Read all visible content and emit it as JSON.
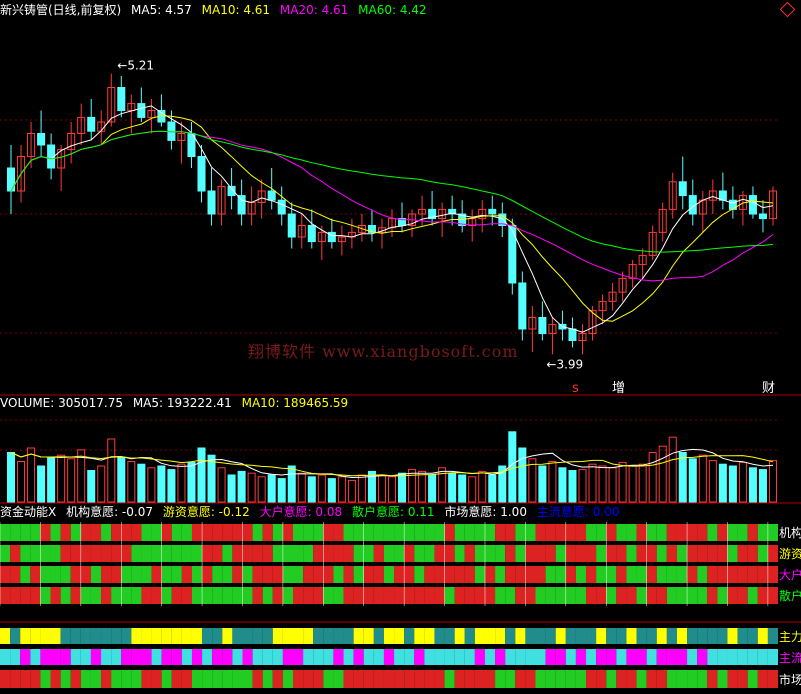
{
  "colors": {
    "up": "#ff3a3a",
    "down": "#54ffff",
    "ma5": "#ffffff",
    "ma10": "#ffff00",
    "ma20": "#ff00ff",
    "ma60": "#00ff00",
    "grid": "#800000",
    "panelBorder": "#b00000"
  },
  "header": {
    "title": "新兴铸管(日线,前复权)",
    "ma5": "MA5: 4.57",
    "ma10": "MA10: 4.61",
    "ma20": "MA20: 4.61",
    "ma60": "MA60: 4.42"
  },
  "annotations": {
    "high": "5.21",
    "low": "3.99",
    "events": [
      {
        "label": "s",
        "color": "#ff3030"
      },
      {
        "label": "增",
        "color": "#ffffff"
      },
      {
        "label": "财",
        "color": "#ffffff"
      }
    ]
  },
  "watermark": "翔博软件 www.xiangbosoft.com",
  "volume": {
    "vol": "VOLUME: 305017.75",
    "ma5": "MA5: 193222.41",
    "ma10": "MA10: 189465.59"
  },
  "fund": {
    "title": "资金动能X",
    "items": [
      {
        "text": "机构意愿: -0.07",
        "color": "#ffffff"
      },
      {
        "text": "游资意愿: -0.12",
        "color": "#ffff00"
      },
      {
        "text": "大户意愿: 0.08",
        "color": "#ff00ff"
      },
      {
        "text": "散户意愿: 0.11",
        "color": "#00ff00"
      },
      {
        "text": "市场意愿: 1.00",
        "color": "#ffffff"
      },
      {
        "text": "主流意愿: 0.00",
        "color": "#0000ff"
      }
    ],
    "rowLabels": [
      {
        "text": "机构",
        "color": "#ffffff"
      },
      {
        "text": "游资",
        "color": "#ffff00"
      },
      {
        "text": "大户",
        "color": "#ff00ff"
      },
      {
        "text": "散户",
        "color": "#00ff00"
      },
      {
        "text": "主力",
        "color": "#ffff00"
      },
      {
        "text": "主流",
        "color": "#ff00ff"
      },
      {
        "text": "市场",
        "color": "#ffffff"
      }
    ]
  },
  "chart_data": {
    "type": "candlestick",
    "title": "新兴铸管(日线,前复权)",
    "high_label": 5.21,
    "low_label": 3.99,
    "price_range": [
      3.9,
      5.4
    ],
    "series": [
      {
        "name": "MA5",
        "value": 4.57
      },
      {
        "name": "MA10",
        "value": 4.61
      },
      {
        "name": "MA20",
        "value": 4.61
      },
      {
        "name": "MA60",
        "value": 4.42
      }
    ],
    "candles": [
      [
        4.8,
        4.9,
        4.6,
        4.7
      ],
      [
        4.7,
        4.9,
        4.65,
        4.85
      ],
      [
        4.85,
        5.0,
        4.8,
        4.95
      ],
      [
        4.95,
        5.05,
        4.85,
        4.9
      ],
      [
        4.9,
        4.95,
        4.75,
        4.8
      ],
      [
        4.8,
        4.9,
        4.7,
        4.88
      ],
      [
        4.88,
        5.0,
        4.82,
        4.95
      ],
      [
        4.95,
        5.08,
        4.9,
        5.02
      ],
      [
        5.02,
        5.1,
        4.92,
        4.96
      ],
      [
        4.96,
        5.05,
        4.9,
        5.0
      ],
      [
        5.0,
        5.21,
        4.98,
        5.15
      ],
      [
        5.15,
        5.2,
        5.02,
        5.05
      ],
      [
        5.05,
        5.12,
        4.95,
        5.08
      ],
      [
        5.08,
        5.15,
        5.0,
        5.02
      ],
      [
        5.02,
        5.1,
        4.95,
        5.05
      ],
      [
        5.05,
        5.12,
        4.98,
        5.0
      ],
      [
        5.0,
        5.05,
        4.88,
        4.92
      ],
      [
        4.92,
        5.0,
        4.82,
        4.95
      ],
      [
        4.95,
        5.0,
        4.8,
        4.85
      ],
      [
        4.85,
        4.9,
        4.65,
        4.7
      ],
      [
        4.7,
        4.8,
        4.55,
        4.6
      ],
      [
        4.6,
        4.75,
        4.55,
        4.72
      ],
      [
        4.72,
        4.8,
        4.62,
        4.68
      ],
      [
        4.68,
        4.75,
        4.55,
        4.6
      ],
      [
        4.6,
        4.72,
        4.55,
        4.65
      ],
      [
        4.65,
        4.75,
        4.58,
        4.7
      ],
      [
        4.7,
        4.8,
        4.62,
        4.66
      ],
      [
        4.66,
        4.72,
        4.55,
        4.6
      ],
      [
        4.6,
        4.65,
        4.45,
        4.5
      ],
      [
        4.5,
        4.6,
        4.45,
        4.55
      ],
      [
        4.55,
        4.62,
        4.45,
        4.48
      ],
      [
        4.48,
        4.55,
        4.4,
        4.52
      ],
      [
        4.52,
        4.58,
        4.45,
        4.48
      ],
      [
        4.48,
        4.55,
        4.42,
        4.5
      ],
      [
        4.5,
        4.58,
        4.45,
        4.52
      ],
      [
        4.52,
        4.6,
        4.48,
        4.55
      ],
      [
        4.55,
        4.62,
        4.48,
        4.52
      ],
      [
        4.52,
        4.58,
        4.45,
        4.54
      ],
      [
        4.54,
        4.62,
        4.5,
        4.58
      ],
      [
        4.58,
        4.65,
        4.52,
        4.55
      ],
      [
        4.55,
        4.62,
        4.5,
        4.6
      ],
      [
        4.6,
        4.68,
        4.55,
        4.62
      ],
      [
        4.62,
        4.7,
        4.55,
        4.58
      ],
      [
        4.58,
        4.65,
        4.5,
        4.62
      ],
      [
        4.62,
        4.68,
        4.55,
        4.6
      ],
      [
        4.6,
        4.66,
        4.52,
        4.55
      ],
      [
        4.55,
        4.62,
        4.48,
        4.58
      ],
      [
        4.58,
        4.66,
        4.52,
        4.62
      ],
      [
        4.62,
        4.68,
        4.55,
        4.6
      ],
      [
        4.6,
        4.65,
        4.5,
        4.55
      ],
      [
        4.55,
        4.58,
        4.25,
        4.3
      ],
      [
        4.3,
        4.35,
        4.05,
        4.1
      ],
      [
        4.1,
        4.2,
        4.0,
        4.15
      ],
      [
        4.15,
        4.22,
        4.05,
        4.08
      ],
      [
        4.08,
        4.15,
        3.99,
        4.12
      ],
      [
        4.12,
        4.18,
        4.05,
        4.1
      ],
      [
        4.1,
        4.15,
        4.02,
        4.05
      ],
      [
        4.05,
        4.12,
        3.99,
        4.08
      ],
      [
        4.08,
        4.2,
        4.05,
        4.18
      ],
      [
        4.18,
        4.25,
        4.12,
        4.22
      ],
      [
        4.22,
        4.3,
        4.18,
        4.26
      ],
      [
        4.26,
        4.35,
        4.22,
        4.32
      ],
      [
        4.32,
        4.4,
        4.28,
        4.38
      ],
      [
        4.38,
        4.45,
        4.32,
        4.42
      ],
      [
        4.42,
        4.55,
        4.4,
        4.52
      ],
      [
        4.52,
        4.65,
        4.48,
        4.62
      ],
      [
        4.62,
        4.78,
        4.58,
        4.74
      ],
      [
        4.74,
        4.85,
        4.62,
        4.68
      ],
      [
        4.68,
        4.75,
        4.55,
        4.6
      ],
      [
        4.6,
        4.7,
        4.52,
        4.66
      ],
      [
        4.66,
        4.75,
        4.6,
        4.7
      ],
      [
        4.7,
        4.78,
        4.62,
        4.66
      ],
      [
        4.66,
        4.72,
        4.58,
        4.62
      ],
      [
        4.62,
        4.7,
        4.55,
        4.68
      ],
      [
        4.68,
        4.72,
        4.58,
        4.6
      ],
      [
        4.6,
        4.66,
        4.52,
        4.58
      ],
      [
        4.58,
        4.72,
        4.55,
        4.7
      ]
    ],
    "volume": [
      0.55,
      0.45,
      0.6,
      0.4,
      0.5,
      0.52,
      0.48,
      0.58,
      0.35,
      0.4,
      0.7,
      0.5,
      0.45,
      0.42,
      0.38,
      0.4,
      0.36,
      0.42,
      0.44,
      0.6,
      0.52,
      0.38,
      0.3,
      0.34,
      0.32,
      0.28,
      0.3,
      0.26,
      0.4,
      0.32,
      0.28,
      0.3,
      0.26,
      0.28,
      0.24,
      0.3,
      0.34,
      0.3,
      0.28,
      0.32,
      0.36,
      0.34,
      0.3,
      0.38,
      0.32,
      0.3,
      0.28,
      0.34,
      0.3,
      0.4,
      0.78,
      0.6,
      0.48,
      0.4,
      0.45,
      0.38,
      0.35,
      0.36,
      0.42,
      0.4,
      0.38,
      0.44,
      0.4,
      0.42,
      0.55,
      0.62,
      0.72,
      0.55,
      0.48,
      0.52,
      0.46,
      0.42,
      0.4,
      0.44,
      0.38,
      0.36,
      0.46
    ]
  }
}
